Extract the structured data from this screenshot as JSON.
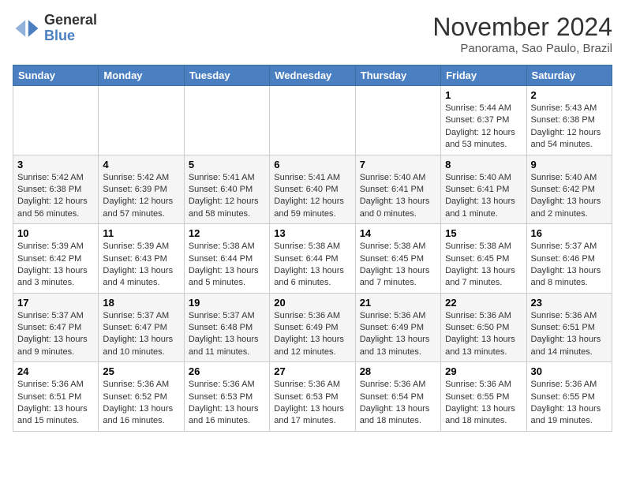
{
  "logo": {
    "general": "General",
    "blue": "Blue"
  },
  "title": "November 2024",
  "location": "Panorama, Sao Paulo, Brazil",
  "weekdays": [
    "Sunday",
    "Monday",
    "Tuesday",
    "Wednesday",
    "Thursday",
    "Friday",
    "Saturday"
  ],
  "weeks": [
    [
      {
        "day": "",
        "info": ""
      },
      {
        "day": "",
        "info": ""
      },
      {
        "day": "",
        "info": ""
      },
      {
        "day": "",
        "info": ""
      },
      {
        "day": "",
        "info": ""
      },
      {
        "day": "1",
        "info": "Sunrise: 5:44 AM\nSunset: 6:37 PM\nDaylight: 12 hours\nand 53 minutes."
      },
      {
        "day": "2",
        "info": "Sunrise: 5:43 AM\nSunset: 6:38 PM\nDaylight: 12 hours\nand 54 minutes."
      }
    ],
    [
      {
        "day": "3",
        "info": "Sunrise: 5:42 AM\nSunset: 6:38 PM\nDaylight: 12 hours\nand 56 minutes."
      },
      {
        "day": "4",
        "info": "Sunrise: 5:42 AM\nSunset: 6:39 PM\nDaylight: 12 hours\nand 57 minutes."
      },
      {
        "day": "5",
        "info": "Sunrise: 5:41 AM\nSunset: 6:40 PM\nDaylight: 12 hours\nand 58 minutes."
      },
      {
        "day": "6",
        "info": "Sunrise: 5:41 AM\nSunset: 6:40 PM\nDaylight: 12 hours\nand 59 minutes."
      },
      {
        "day": "7",
        "info": "Sunrise: 5:40 AM\nSunset: 6:41 PM\nDaylight: 13 hours\nand 0 minutes."
      },
      {
        "day": "8",
        "info": "Sunrise: 5:40 AM\nSunset: 6:41 PM\nDaylight: 13 hours\nand 1 minute."
      },
      {
        "day": "9",
        "info": "Sunrise: 5:40 AM\nSunset: 6:42 PM\nDaylight: 13 hours\nand 2 minutes."
      }
    ],
    [
      {
        "day": "10",
        "info": "Sunrise: 5:39 AM\nSunset: 6:42 PM\nDaylight: 13 hours\nand 3 minutes."
      },
      {
        "day": "11",
        "info": "Sunrise: 5:39 AM\nSunset: 6:43 PM\nDaylight: 13 hours\nand 4 minutes."
      },
      {
        "day": "12",
        "info": "Sunrise: 5:38 AM\nSunset: 6:44 PM\nDaylight: 13 hours\nand 5 minutes."
      },
      {
        "day": "13",
        "info": "Sunrise: 5:38 AM\nSunset: 6:44 PM\nDaylight: 13 hours\nand 6 minutes."
      },
      {
        "day": "14",
        "info": "Sunrise: 5:38 AM\nSunset: 6:45 PM\nDaylight: 13 hours\nand 7 minutes."
      },
      {
        "day": "15",
        "info": "Sunrise: 5:38 AM\nSunset: 6:45 PM\nDaylight: 13 hours\nand 7 minutes."
      },
      {
        "day": "16",
        "info": "Sunrise: 5:37 AM\nSunset: 6:46 PM\nDaylight: 13 hours\nand 8 minutes."
      }
    ],
    [
      {
        "day": "17",
        "info": "Sunrise: 5:37 AM\nSunset: 6:47 PM\nDaylight: 13 hours\nand 9 minutes."
      },
      {
        "day": "18",
        "info": "Sunrise: 5:37 AM\nSunset: 6:47 PM\nDaylight: 13 hours\nand 10 minutes."
      },
      {
        "day": "19",
        "info": "Sunrise: 5:37 AM\nSunset: 6:48 PM\nDaylight: 13 hours\nand 11 minutes."
      },
      {
        "day": "20",
        "info": "Sunrise: 5:36 AM\nSunset: 6:49 PM\nDaylight: 13 hours\nand 12 minutes."
      },
      {
        "day": "21",
        "info": "Sunrise: 5:36 AM\nSunset: 6:49 PM\nDaylight: 13 hours\nand 13 minutes."
      },
      {
        "day": "22",
        "info": "Sunrise: 5:36 AM\nSunset: 6:50 PM\nDaylight: 13 hours\nand 13 minutes."
      },
      {
        "day": "23",
        "info": "Sunrise: 5:36 AM\nSunset: 6:51 PM\nDaylight: 13 hours\nand 14 minutes."
      }
    ],
    [
      {
        "day": "24",
        "info": "Sunrise: 5:36 AM\nSunset: 6:51 PM\nDaylight: 13 hours\nand 15 minutes."
      },
      {
        "day": "25",
        "info": "Sunrise: 5:36 AM\nSunset: 6:52 PM\nDaylight: 13 hours\nand 16 minutes."
      },
      {
        "day": "26",
        "info": "Sunrise: 5:36 AM\nSunset: 6:53 PM\nDaylight: 13 hours\nand 16 minutes."
      },
      {
        "day": "27",
        "info": "Sunrise: 5:36 AM\nSunset: 6:53 PM\nDaylight: 13 hours\nand 17 minutes."
      },
      {
        "day": "28",
        "info": "Sunrise: 5:36 AM\nSunset: 6:54 PM\nDaylight: 13 hours\nand 18 minutes."
      },
      {
        "day": "29",
        "info": "Sunrise: 5:36 AM\nSunset: 6:55 PM\nDaylight: 13 hours\nand 18 minutes."
      },
      {
        "day": "30",
        "info": "Sunrise: 5:36 AM\nSunset: 6:55 PM\nDaylight: 13 hours\nand 19 minutes."
      }
    ]
  ]
}
